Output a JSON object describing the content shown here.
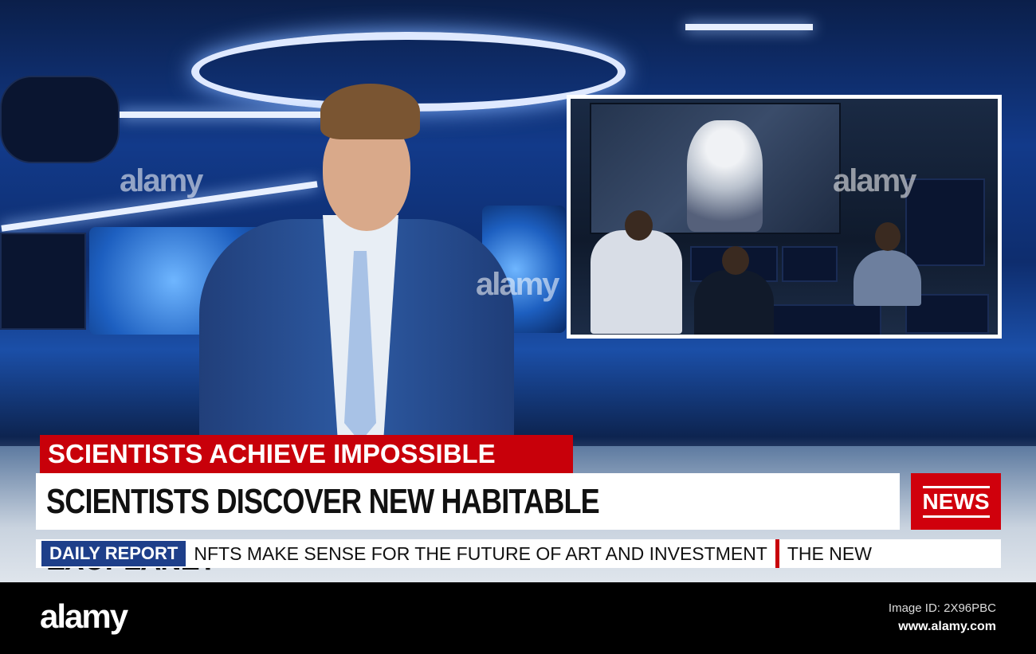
{
  "lower_third": {
    "kicker": "SCIENTISTS ACHIEVE IMPOSSIBLE",
    "headline": "SCIENTISTS DISCOVER NEW HABITABLE EXOPLANET",
    "badge": "NEWS"
  },
  "ticker": {
    "label": "DAILY REPORT",
    "items": [
      "NFTS MAKE SENSE FOR THE FUTURE OF ART AND INVESTMENT",
      "THE NEW"
    ]
  },
  "watermark": {
    "text": "alamy"
  },
  "footer": {
    "logo": "alamy",
    "image_id": "Image ID: 2X96PBC",
    "site": "www.alamy.com"
  },
  "colors": {
    "red": "#c8000a",
    "blue": "#1e3f8a"
  }
}
